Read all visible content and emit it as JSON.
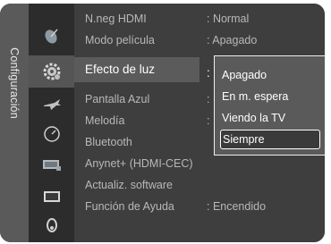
{
  "sidebar": {
    "section_label": "Configuración"
  },
  "icons": [
    {
      "name": "satellite-dish-icon"
    },
    {
      "name": "gear-icon"
    },
    {
      "name": "airplane-icon"
    },
    {
      "name": "compass-icon"
    },
    {
      "name": "input-source-icon"
    },
    {
      "name": "screen-icon"
    },
    {
      "name": "headset-icon"
    }
  ],
  "menu": {
    "items": [
      {
        "label": "N.neg HDMI",
        "value": ": Normal"
      },
      {
        "label": "Modo película",
        "value": ": Apagado"
      },
      {
        "label": "Efecto de luz",
        "value": ":"
      },
      {
        "label": "Pantalla Azul",
        "value": ":"
      },
      {
        "label": "Melodía",
        "value": ":"
      },
      {
        "label": "Bluetooth",
        "value": ""
      },
      {
        "label": "Anynet+ (HDMI-CEC)",
        "value": ""
      },
      {
        "label": "Actualiz. software",
        "value": ""
      },
      {
        "label": "Función de Ayuda",
        "value": ": Encendido"
      }
    ],
    "active_index": 2
  },
  "dropdown": {
    "options": [
      "Apagado",
      "En m. espera",
      "Viendo la TV",
      "Siempre"
    ],
    "selected_index": 3
  },
  "colors": {
    "panel": "#3e3e3e",
    "icon_column": "#2c2c2c",
    "highlight": "#5b5b5b",
    "text_dim": "#b8b8b8",
    "text_active": "#ffffff"
  }
}
